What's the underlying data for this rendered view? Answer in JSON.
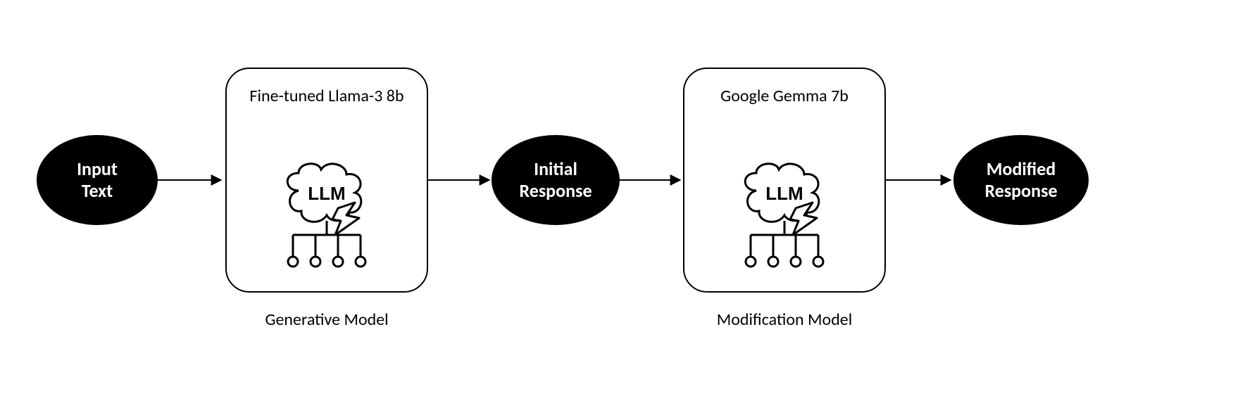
{
  "nodes": {
    "input": {
      "line1": "Input",
      "line2": "Text"
    },
    "initial": {
      "line1": "Initial",
      "line2": "Response"
    },
    "modified": {
      "line1": "Modified",
      "line2": "Response"
    }
  },
  "boxes": {
    "generative": {
      "title": "Fine-tuned Llama-3 8b",
      "caption": "Generative Model",
      "icon_label": "LLM"
    },
    "modification": {
      "title": "Google Gemma 7b",
      "caption": "Modification Model",
      "icon_label": "LLM"
    }
  }
}
